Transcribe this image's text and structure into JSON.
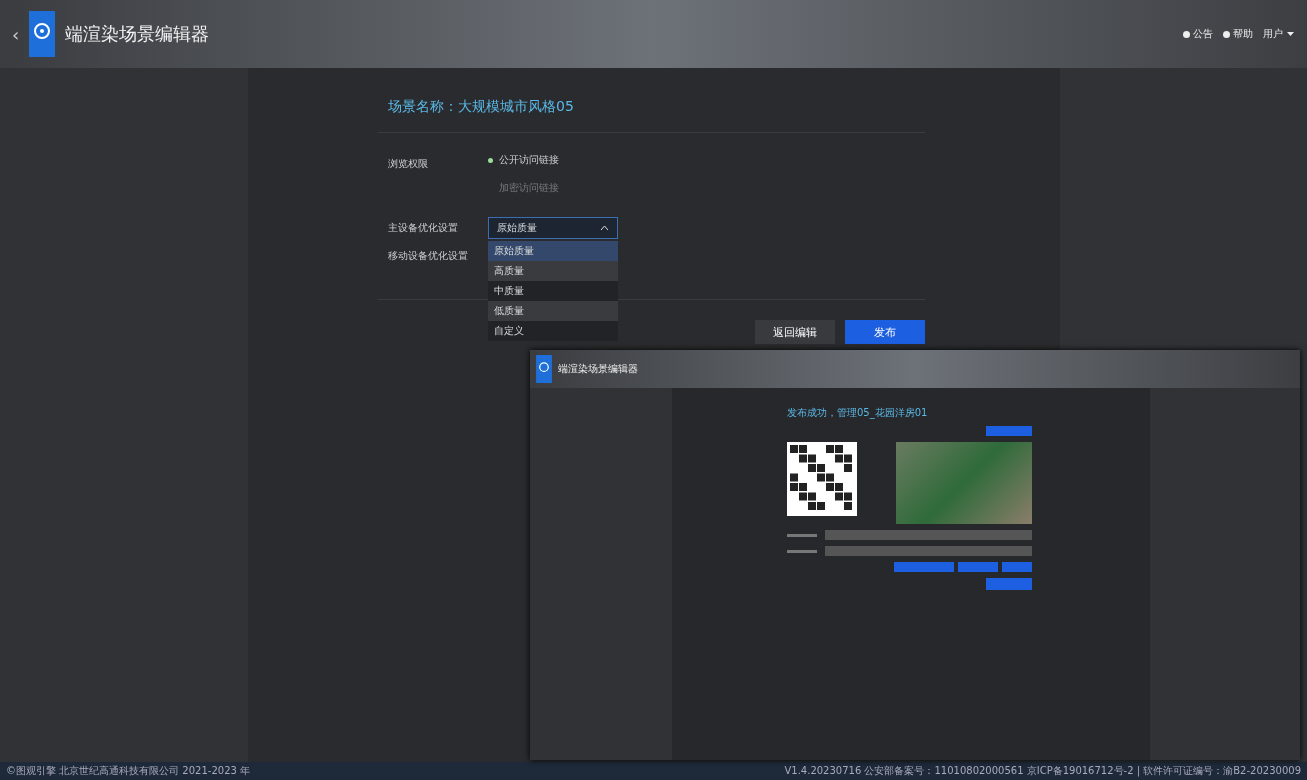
{
  "header": {
    "back": "‹",
    "title": "端渲染场景编辑器",
    "links": [
      {
        "label": "公告"
      },
      {
        "label": "帮助"
      }
    ],
    "user": "用户"
  },
  "form": {
    "scene_name": "场景名称：大规模城市风格05",
    "permission": {
      "label": "浏览权限",
      "options": [
        {
          "label": "公开访问链接",
          "selected": true
        },
        {
          "label": "加密访问链接",
          "selected": false
        }
      ]
    },
    "main_device": {
      "label": "主设备优化设置",
      "value": "原始质量",
      "expanded": true,
      "options": [
        {
          "label": "原始质量",
          "selected": true
        },
        {
          "label": "高质量",
          "selected": false
        },
        {
          "label": "中质量",
          "selected": false
        },
        {
          "label": "低质量",
          "selected": false
        },
        {
          "label": "自定义",
          "selected": false
        }
      ]
    },
    "mobile_device": {
      "label": "移动设备优化设置"
    },
    "buttons": [
      {
        "label": "返回编辑",
        "primary": false
      },
      {
        "label": "发布",
        "primary": true
      }
    ]
  },
  "inset": {
    "title": "端渲染场景编辑器",
    "message": "发布成功，管理05_花园洋房01"
  },
  "footer": {
    "left": "©图观引擎 北京世纪高通科技有限公司 2021-2023 年",
    "right": "V1.4.20230716 公安部备案号：11010802000561 京ICP备19016712号-2 | 软件许可证编号：渝B2-20230009"
  }
}
